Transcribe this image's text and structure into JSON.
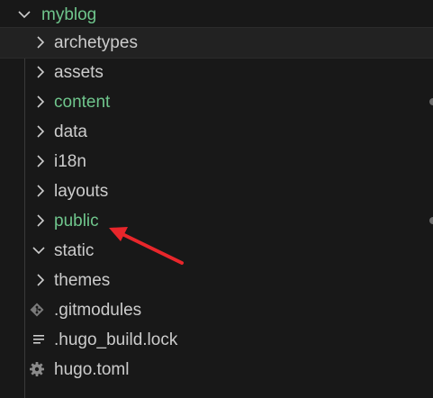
{
  "explorer": {
    "root": {
      "label": "myblog",
      "expanded": true,
      "color": "#6fc58c"
    },
    "items": [
      {
        "label": "archetypes",
        "kind": "folder",
        "expanded": false,
        "color": "#cccccc"
      },
      {
        "label": "assets",
        "kind": "folder",
        "expanded": false,
        "color": "#cccccc"
      },
      {
        "label": "content",
        "kind": "folder",
        "expanded": false,
        "color": "#6fc58c"
      },
      {
        "label": "data",
        "kind": "folder",
        "expanded": false,
        "color": "#cccccc"
      },
      {
        "label": "i18n",
        "kind": "folder",
        "expanded": false,
        "color": "#cccccc"
      },
      {
        "label": "layouts",
        "kind": "folder",
        "expanded": false,
        "color": "#cccccc"
      },
      {
        "label": "public",
        "kind": "folder",
        "expanded": false,
        "color": "#6fc58c"
      },
      {
        "label": "static",
        "kind": "folder",
        "expanded": true,
        "color": "#cccccc"
      },
      {
        "label": "themes",
        "kind": "folder",
        "expanded": false,
        "color": "#cccccc"
      },
      {
        "label": ".gitmodules",
        "kind": "file",
        "icon": "git-icon",
        "color": "#cccccc"
      },
      {
        "label": ".hugo_build.lock",
        "kind": "file",
        "icon": "lines-icon",
        "color": "#cccccc"
      },
      {
        "label": "hugo.toml",
        "kind": "file",
        "icon": "gear-icon",
        "color": "#cccccc"
      }
    ]
  },
  "colors": {
    "background": "#181818",
    "text": "#cccccc",
    "modified_green": "#6fc58c",
    "arrow_red": "#e8262b"
  }
}
